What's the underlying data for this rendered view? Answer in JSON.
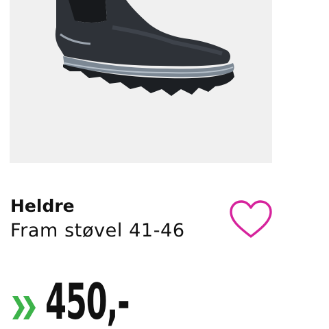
{
  "product": {
    "brand": "Heldre",
    "name": "Fram støvel 41-46",
    "price": "450,-",
    "image_icon": "boot-image",
    "favorite_icon": "heart-outline-icon",
    "badge_icon": "double-chevron-right-icon"
  },
  "colors": {
    "heart": "#d6239c",
    "chevron": "#3db34a",
    "image_bg": "#f0f0f0",
    "text": "#111111"
  }
}
